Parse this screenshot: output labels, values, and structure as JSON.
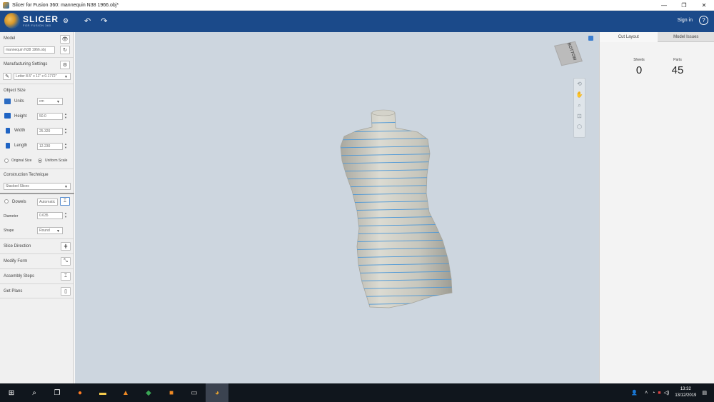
{
  "window": {
    "title": "Slicer for Fusion 360: mannequin N38 1966.obj*",
    "minimize": "—",
    "maximize": "❐",
    "close": "✕"
  },
  "header": {
    "logo_name": "SLICER",
    "logo_sub": "FOR FUSION 360",
    "sign_in": "Sign in",
    "help": "?"
  },
  "left": {
    "model_label": "Model",
    "model_file": "mannequin N38 1966.obj",
    "manufacturing_label": "Manufacturing Settings",
    "manufacturing_value": "Letter 8.5\" x 11\" x 0.1772\"",
    "object_size_label": "Object Size",
    "units_label": "Units",
    "units_value": "cm",
    "height_label": "Height",
    "height_value": "50.0",
    "width_label": "Width",
    "width_value": "25.320",
    "length_label": "Length",
    "length_value": "12.230",
    "original_size_label": "Original Size",
    "uniform_scale_label": "Uniform Scale",
    "construction_label": "Construction Technique",
    "construction_value": "Stacked Slices",
    "dowels_label": "Dowels",
    "dowels_mode": "Automatic",
    "diameter_label": "Diameter",
    "diameter_value": "0.635",
    "shape_label": "Shape",
    "shape_value": "Round",
    "nav": [
      {
        "label": "Slice Direction",
        "icon": "slice-direction-icon"
      },
      {
        "label": "Modify Form",
        "icon": "modify-form-icon"
      },
      {
        "label": "Assembly Steps",
        "icon": "assembly-steps-icon"
      },
      {
        "label": "Get Plans",
        "icon": "get-plans-icon"
      }
    ]
  },
  "viewport": {
    "cube_face": "BOTTOM"
  },
  "right": {
    "tabs": [
      "Cut Layout",
      "Model Issues"
    ],
    "active_tab": "Cut Layout",
    "sheets_label": "Sheets",
    "sheets_value": "0",
    "parts_label": "Parts",
    "parts_value": "45"
  },
  "taskbar": {
    "time": "13:32",
    "date": "13/12/2019"
  },
  "colors": {
    "header_bg": "#1b4a8a",
    "viewport_bg": "#cdd6df",
    "slice_line": "#4a97d8",
    "model_fill": "#c9c8bf"
  }
}
